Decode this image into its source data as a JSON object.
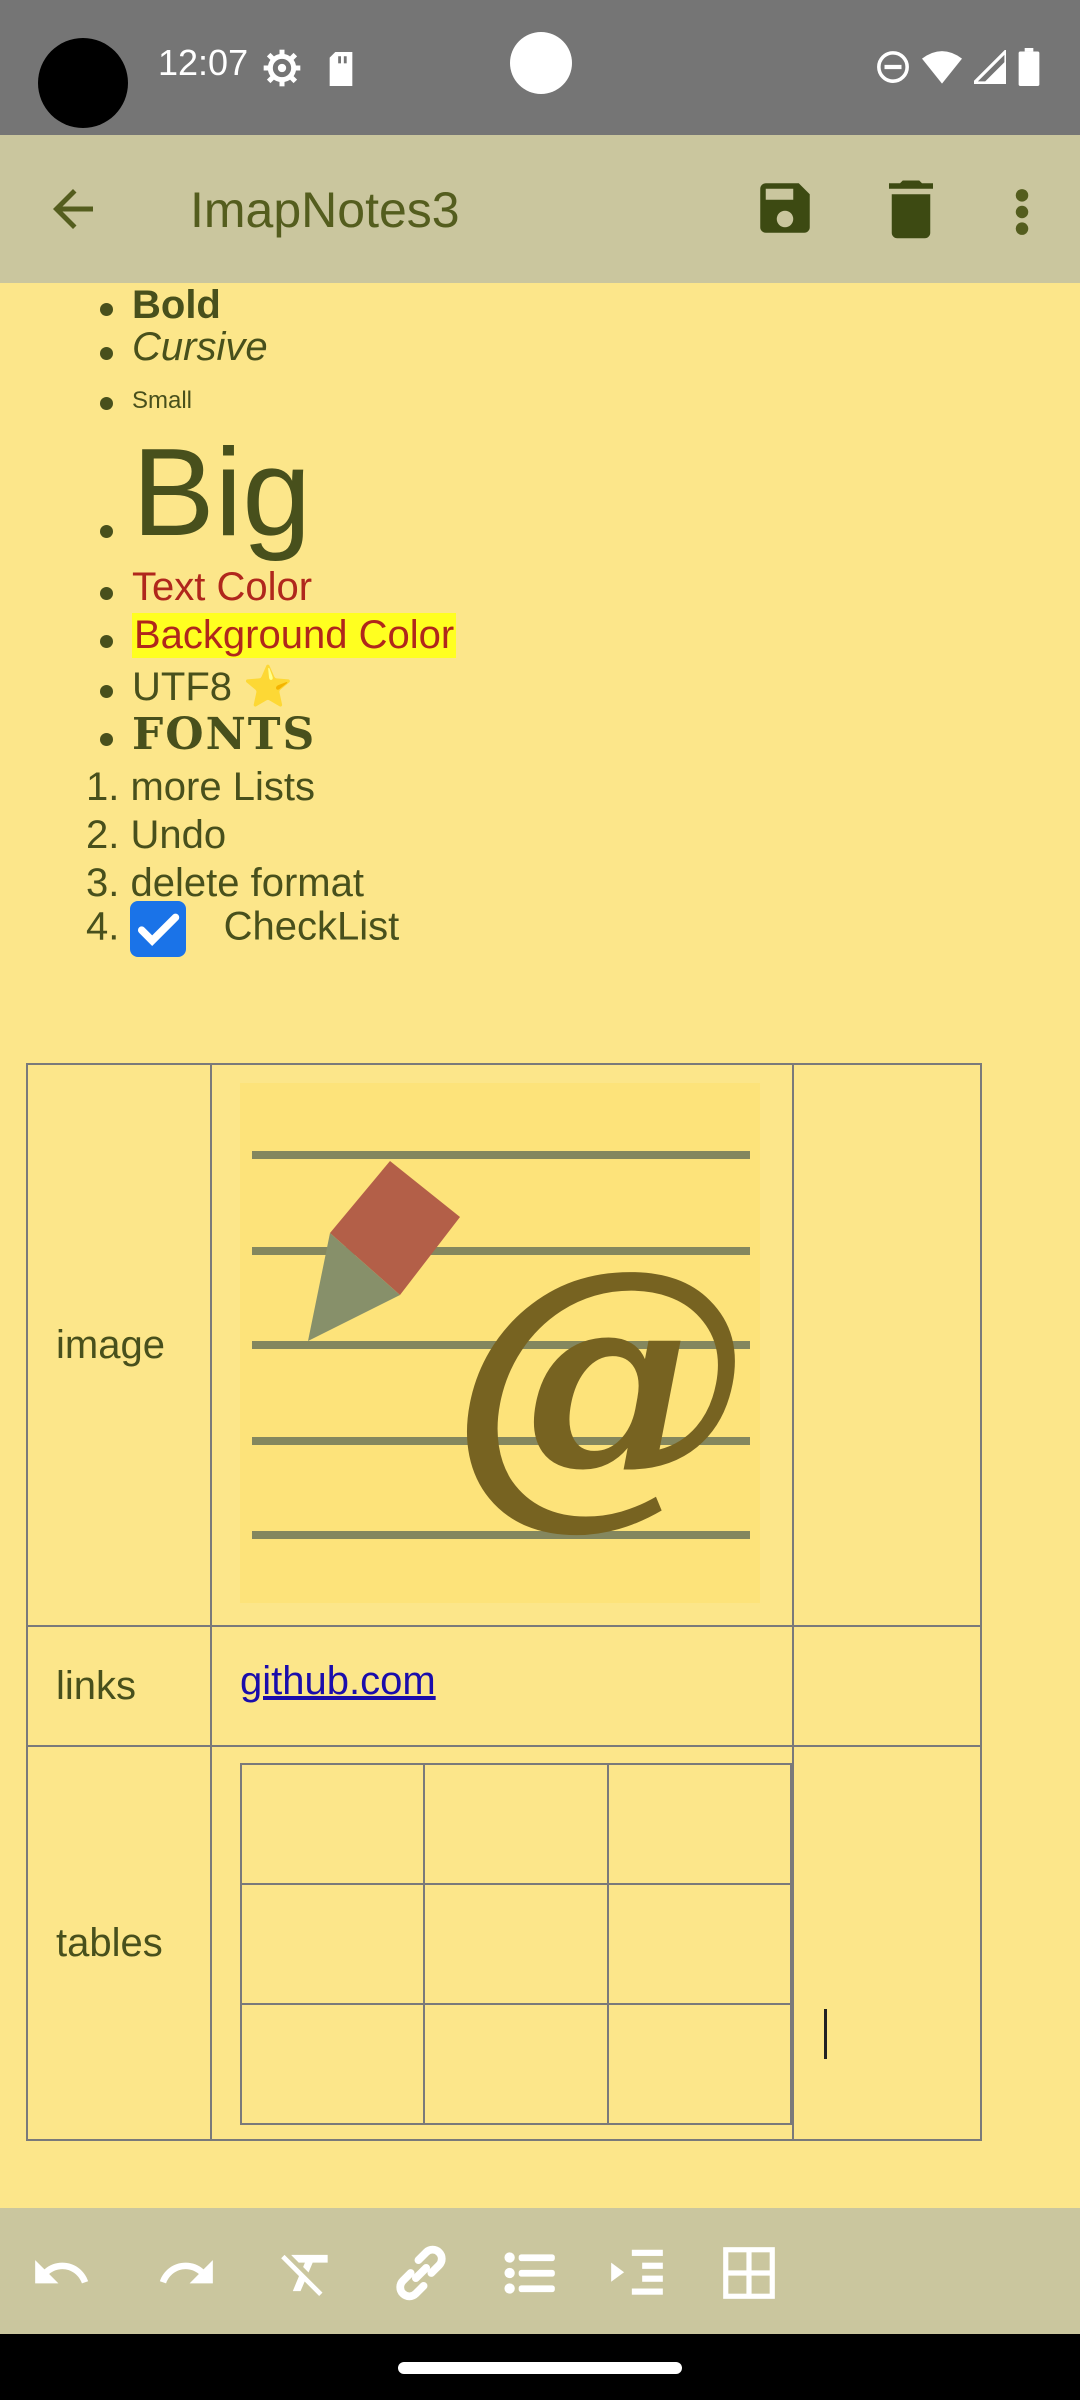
{
  "status_bar": {
    "time": "12:07"
  },
  "app_bar": {
    "title": "ImapNotes3"
  },
  "note": {
    "bullets": {
      "bold": "Bold",
      "cursive": "Cursive",
      "small": "Small",
      "big": "Big",
      "text_color": "Text Color",
      "background_color": "Background Color",
      "utf8": "UTF8",
      "utf8_emoji": "⭐",
      "fonts": "FONTS"
    },
    "numbered": [
      {
        "num": "1.",
        "text": "more Lists"
      },
      {
        "num": "2.",
        "text": "Undo"
      },
      {
        "num": "3.",
        "text": "delete format"
      },
      {
        "num": "4.",
        "text": "CheckList",
        "checked": true
      }
    ],
    "table": {
      "rows": [
        {
          "label": "image"
        },
        {
          "label": "links",
          "link": "github.com"
        },
        {
          "label": "tables"
        }
      ]
    }
  },
  "colors": {
    "background": "#fce68a",
    "app_bar": "#cac69e",
    "accent": "#48501c",
    "text_color": "#b0271c",
    "highlight": "#ffff20",
    "checkbox": "#1a73e8"
  },
  "icons": {
    "app_bar": [
      "back-arrow-icon",
      "save-icon",
      "delete-icon",
      "more-vert-icon"
    ],
    "toolbar": [
      "undo-icon",
      "redo-icon",
      "clear-format-icon",
      "link-icon",
      "bullet-list-icon",
      "indent-icon",
      "table-icon"
    ]
  }
}
